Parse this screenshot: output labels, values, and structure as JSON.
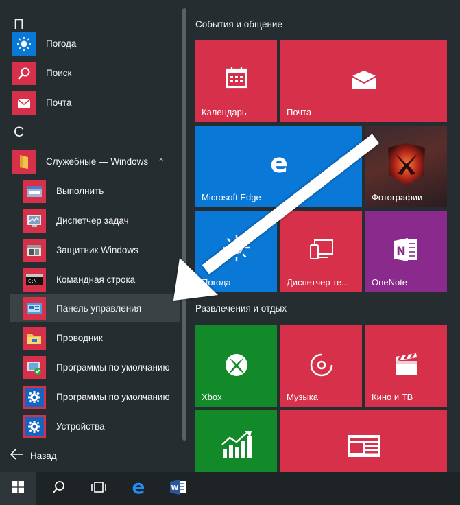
{
  "apps": {
    "letter_p": "П",
    "letter_s": "С",
    "pogoda": "Погода",
    "poisk": "Поиск",
    "pochta": "Почта",
    "folder": "Служебные — Windows",
    "sub_items": [
      "Выполнить",
      "Диспетчер задач",
      "Защитник Windows",
      "Командная строка",
      "Панель управления",
      "Проводник",
      "Программы по умолчанию",
      "Программы по умолчанию",
      "Устройства"
    ],
    "back": "Назад"
  },
  "tiles": {
    "section1": "События и общение",
    "section2": "Развлечения и отдых",
    "calendar": "Календарь",
    "mail": "Почта",
    "edge": "Microsoft Edge",
    "photos": "Фотографии",
    "weather": "Погода",
    "phone": "Диспетчер те...",
    "onenote": "OneNote",
    "xbox": "Xbox",
    "music": "Музыка",
    "movies": "Кино и ТВ"
  },
  "taskbar": {
    "icons": [
      "windows-logo-icon",
      "search-icon",
      "task-view-icon",
      "edge-icon",
      "word-icon"
    ]
  },
  "colors": {
    "tile_red": "#d6304a",
    "tile_blue": "#0a78d6",
    "tile_purple": "#8a2a8c",
    "tile_green": "#128a2a",
    "background": "#262d31"
  }
}
